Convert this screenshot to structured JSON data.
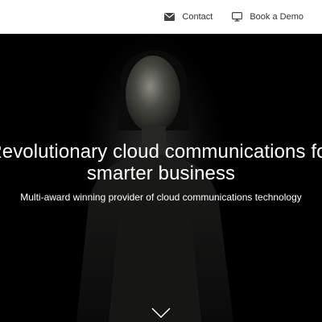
{
  "nav": {
    "contact_label": "Contact",
    "demo_label": "Book a Demo"
  },
  "hero": {
    "headline_line1": "Revolutionary cloud communications for",
    "headline_line2": "smarter business",
    "subheadline": "Multi-award winning provider of cloud communications technology"
  },
  "colors": {
    "topbar_bg": "#ffffff",
    "hero_bg": "#000000",
    "text_light": "#ffffff",
    "nav_text": "#333333"
  },
  "icons": {
    "contact": "envelope-icon",
    "demo": "monitor-icon",
    "scroll": "chevron-down-icon"
  }
}
